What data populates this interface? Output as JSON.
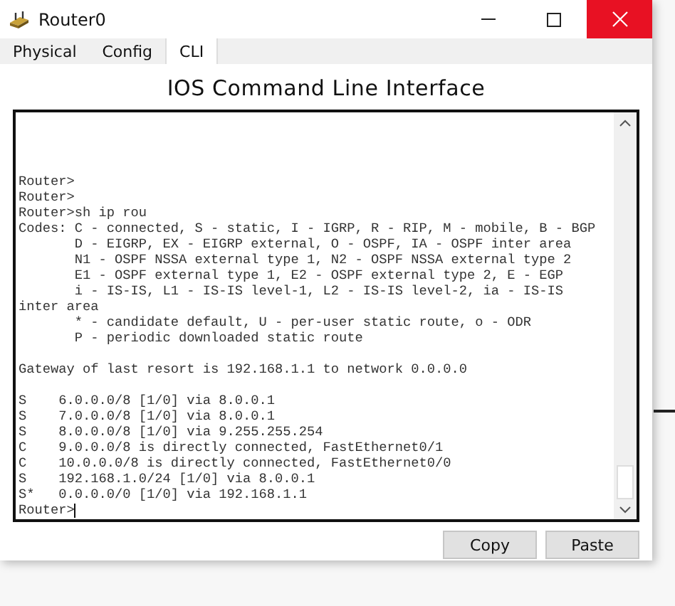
{
  "window": {
    "title": "Router0"
  },
  "tabs": [
    {
      "label": "Physical",
      "selected": false
    },
    {
      "label": "Config",
      "selected": false
    },
    {
      "label": "CLI",
      "selected": true
    }
  ],
  "heading": "IOS Command Line Interface",
  "terminal": {
    "blocks": [
      {
        "lines": [
          "Router>",
          "Router>",
          "Router>sh ip rou",
          "Codes: C - connected, S - static, I - IGRP, R - RIP, M - mobile, B - BGP",
          "       D - EIGRP, EX - EIGRP external, O - OSPF, IA - OSPF inter area",
          "       N1 - OSPF NSSA external type 1, N2 - OSPF NSSA external type 2",
          "       E1 - OSPF external type 1, E2 - OSPF external type 2, E - EGP",
          "       i - IS-IS, L1 - IS-IS level-1, L2 - IS-IS level-2, ia - IS-IS",
          "inter area",
          "       * - candidate default, U - per-user static route, o - ODR",
          "       P - periodic downloaded static route"
        ]
      },
      {
        "lines": [
          "Gateway of last resort is 192.168.1.1 to network 0.0.0.0"
        ]
      },
      {
        "lines": [
          "S    6.0.0.0/8 [1/0] via 8.0.0.1",
          "S    7.0.0.0/8 [1/0] via 8.0.0.1",
          "S    8.0.0.0/8 [1/0] via 9.255.255.254",
          "C    9.0.0.0/8 is directly connected, FastEthernet0/1",
          "C    10.0.0.0/8 is directly connected, FastEthernet0/0",
          "S    192.168.1.0/24 [1/0] via 8.0.0.1",
          "S*   0.0.0.0/0 [1/0] via 192.168.1.1"
        ]
      }
    ],
    "prompt": "Router>"
  },
  "buttons": [
    "Copy",
    "Paste"
  ]
}
